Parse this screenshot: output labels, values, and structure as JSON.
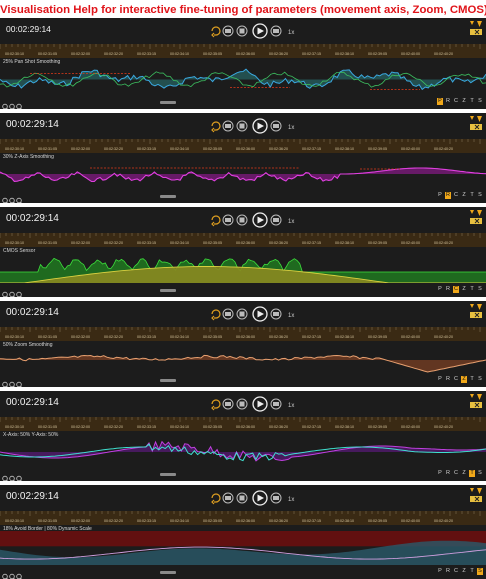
{
  "title": "Visualisation Help for interactive fine-tuning of parameters (movement axis, Zoom, CMOS)",
  "ticks": [
    "00:02:30:10",
    "00:02:31:05",
    "00:02:32:00",
    "00:02:32:20",
    "00:02:33:15",
    "00:02:34:10",
    "00:02:35:05",
    "00:02:36:00",
    "00:02:36:20",
    "00:02:37:15",
    "00:02:38:10",
    "00:02:39:05",
    "00:02:40:00",
    "00:02:40:20"
  ],
  "speed": "1x",
  "panels": [
    {
      "timecode": "00:02:29:14",
      "label": "25% Pan Shot Smoothing",
      "modes": [
        "P",
        "R",
        "C",
        "Z",
        "T",
        "S"
      ],
      "active_mode": 0
    },
    {
      "timecode": "00:02:29:14",
      "label": "30% Z-Axis Smoothing",
      "modes": [
        "P",
        "R",
        "C",
        "Z",
        "T",
        "S"
      ],
      "active_mode": 1
    },
    {
      "timecode": "00:02:29:14",
      "label": "CMOS Sensor",
      "modes": [
        "P",
        "R",
        "C",
        "Z",
        "T",
        "S"
      ],
      "active_mode": 2
    },
    {
      "timecode": "00:02:29:14",
      "label": "50% Zoom Smoothing",
      "modes": [
        "P",
        "R",
        "C",
        "Z",
        "T",
        "S"
      ],
      "active_mode": 3
    },
    {
      "timecode": "00:02:29:14",
      "label": "X-Axis: 50%  Y-Axis: 50%",
      "modes": [
        "P",
        "R",
        "C",
        "Z",
        "T",
        "S"
      ],
      "active_mode": 4
    },
    {
      "timecode": "00:02:29:14",
      "label": "18% Avoid Border | 80% Dynamic Scale",
      "modes": [
        "P",
        "R",
        "C",
        "Z",
        "T",
        "S"
      ],
      "active_mode": 5
    }
  ],
  "colors": {
    "accent": "#f0a81a",
    "title": "#e0141a",
    "panel": "#1c1c1c",
    "ruler": "#3a2a14",
    "marker": "#e03a1a"
  }
}
